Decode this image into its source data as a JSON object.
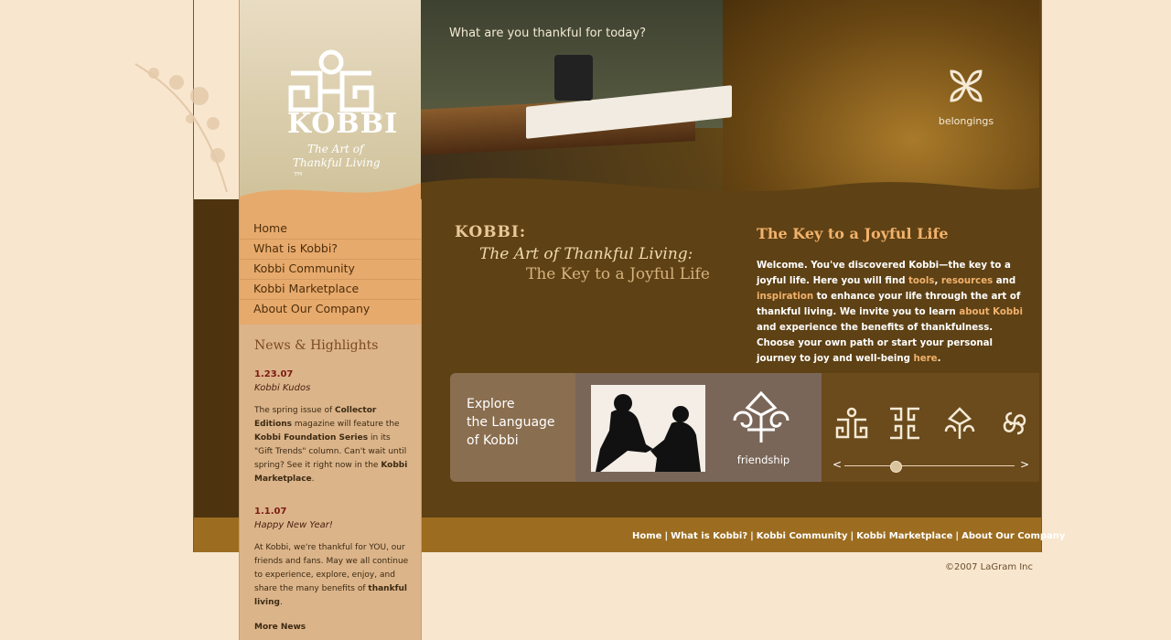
{
  "brand": {
    "name": "KOBBI",
    "registered": "®",
    "tagline_line1": "The Art of",
    "tagline_line2": "Thankful Living ™"
  },
  "nav": [
    {
      "label": "Home"
    },
    {
      "label": "What is Kobbi?"
    },
    {
      "label": "Kobbi Community"
    },
    {
      "label": "Kobbi Marketplace"
    },
    {
      "label": "About Our Company"
    }
  ],
  "news": {
    "heading": "News & Highlights",
    "items": [
      {
        "date": "1.23.07",
        "headline": "Kobbi Kudos",
        "text_pre": "The spring issue of ",
        "bold1": "Collector Editions",
        "text_mid": " magazine will feature the ",
        "bold2": "Kobbi Foundation Series",
        "text_mid2": " in its \"Gift Trends\" column. Can't wait until spring? See it right now in the ",
        "bold3": "Kobbi Marketplace",
        "text_end": "."
      },
      {
        "date": "1.1.07",
        "headline": "Happy New Year!",
        "text_pre": "At Kobbi, we're thankful for YOU, our friends and fans. May we all continue to experience, explore, enjoy, and share the many benefits of ",
        "bold1": "thankful living",
        "text_end": "."
      }
    ],
    "more_label": "More News"
  },
  "hero": {
    "question": "What are you thankful for today?",
    "badge_label": "belongings"
  },
  "intro": {
    "line1": "KOBBI:",
    "line2": "The Art of Thankful Living:",
    "line3": "The Key to a Joyful Life"
  },
  "welcome": {
    "title": "The Key to a Joyful Life",
    "p1": "Welcome. You've discovered Kobbi—the key to a joyful life. Here you will find ",
    "link_tools": "tools",
    "sep1": ", ",
    "link_resources": "resources",
    "p2": " and ",
    "link_inspiration": "inspiration",
    "p3": " to enhance your life through the art of thankful living. We invite you to learn ",
    "link_about": "about Kobbi",
    "p4": " and experience the benefits of thankfulness. Choose your own path or start your personal journey to joy and well-being ",
    "link_here": "here",
    "p5": "."
  },
  "explore": {
    "line1": "Explore",
    "line2": "the Language",
    "line3": "of Kobbi",
    "feature_label": "friendship",
    "prev": "<",
    "next": ">",
    "slider_position": 0.3
  },
  "footer": {
    "links": [
      "Home",
      "What is Kobbi?",
      "Kobbi Community",
      "Kobbi Marketplace",
      "About Our Company"
    ],
    "separator": "|",
    "copyright": "©2007 LaGram Inc"
  },
  "colors": {
    "accent": "#f2b26c",
    "frame": "#5e4114",
    "sidebar": "#dcb48a",
    "nav": "#e7aa6d",
    "background": "#f8e6cf"
  }
}
